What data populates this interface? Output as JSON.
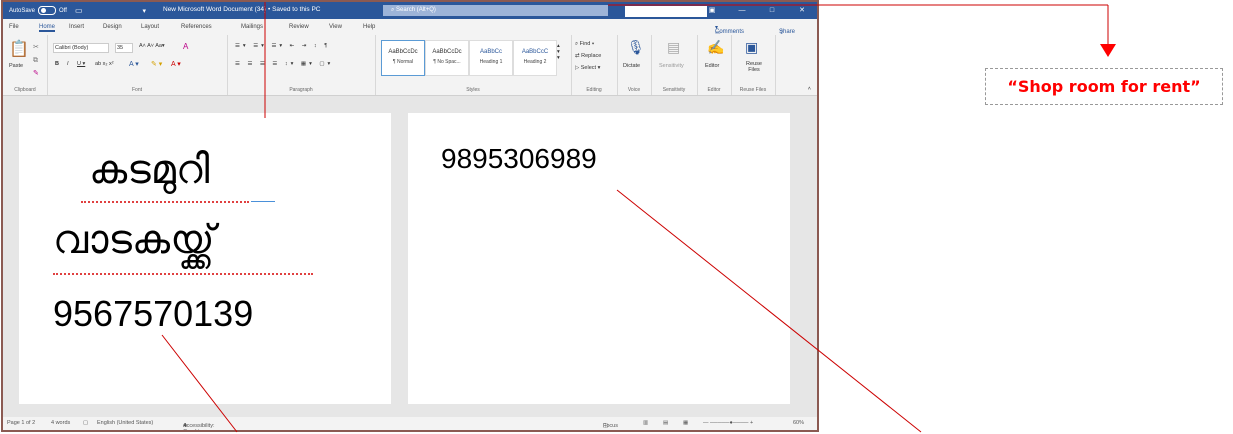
{
  "window": {
    "autosave_label": "AutoSave",
    "autosave_state": "Off",
    "title": "New Microsoft Word Document (34) • Saved to this PC",
    "search_placeholder": "Search (Alt+Q)",
    "minimize_icon": "minimize-icon",
    "maximize_icon": "maximize-icon",
    "close_icon": "close-icon"
  },
  "menu": {
    "items": [
      "File",
      "Home",
      "Insert",
      "Design",
      "Layout",
      "References",
      "Mailings",
      "Review",
      "View",
      "Help"
    ],
    "active": "Home",
    "comments_label": "Comments",
    "share_label": "Share"
  },
  "ribbon": {
    "clipboard": {
      "paste_label": "Paste",
      "group_label": "Clipboard"
    },
    "font": {
      "font_name": "Calibri (Body)",
      "font_size": "35",
      "group_label": "Font"
    },
    "paragraph": {
      "group_label": "Paragraph"
    },
    "styles": {
      "items": [
        {
          "preview": "AaBbCcDc",
          "name": "¶ Normal"
        },
        {
          "preview": "AaBbCcDc",
          "name": "¶ No Spac..."
        },
        {
          "preview": "AaBbCc",
          "name": "Heading 1"
        },
        {
          "preview": "AaBbCcC",
          "name": "Heading 2"
        }
      ],
      "group_label": "Styles"
    },
    "editing": {
      "find": "Find",
      "replace": "Replace",
      "select": "Select",
      "group_label": "Editing"
    },
    "voice": {
      "dictate": "Dictate",
      "group_label": "Voice"
    },
    "sensitivity": {
      "label": "Sensitivity",
      "group_label": "Sensitivity"
    },
    "editor": {
      "label": "Editor",
      "group_label": "Editor"
    },
    "reuse": {
      "label": "Reuse Files",
      "group_label": "Reuse Files"
    }
  },
  "document": {
    "page1": {
      "line1": "കടമുറി",
      "line2": "വാടകയ്ക്ക്",
      "phone": "9567570139"
    },
    "page2": {
      "phone": "9895306989"
    }
  },
  "status": {
    "page": "Page 1 of 2",
    "words": "4 words",
    "language": "English (United States)",
    "accessibility": "Accessibility: Good to go",
    "focus": "Focus",
    "zoom": "60%"
  },
  "annotation": {
    "text": "“Shop room for rent”",
    "color": "#ff0000"
  }
}
